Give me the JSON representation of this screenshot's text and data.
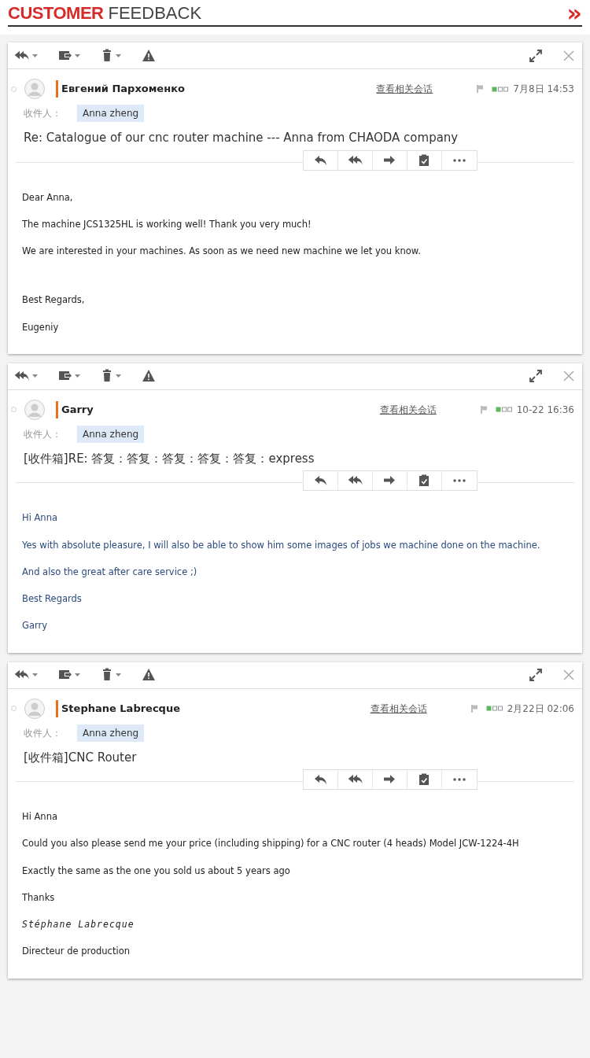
{
  "header": {
    "title_strong": "CUSTOMER",
    "title_light": "FEEDBACK",
    "arrow": "»"
  },
  "emails": [
    {
      "sender": "Евгений Пархоменко",
      "related_link": "查看相关会话",
      "date": "7月8日 14:53",
      "recipient_label": "收件人：",
      "recipient": "Anna zheng",
      "subject": "Re: Catalogue of our cnc router machine --- Anna from CHAODA company",
      "color": "#222222",
      "body": [
        {
          "kind": "text",
          "text": "Dear Anna,"
        },
        {
          "kind": "text",
          "text": "The machine JCS1325HL is working well! Thank you very much!"
        },
        {
          "kind": "text",
          "text": "We are interested in your machines. As soon as we need new machine we let you know."
        },
        {
          "kind": "gap"
        },
        {
          "kind": "text",
          "text": "Best Regards,"
        },
        {
          "kind": "text",
          "text": "Eugeniy"
        }
      ]
    },
    {
      "sender": "Garry",
      "related_link": "查看相关会话",
      "date": "10-22 16:36",
      "recipient_label": "收件人：",
      "recipient": "Anna zheng",
      "subject": "[收件箱]RE: 答复：答复：答复：答复：答复：express",
      "color": "#2b4a7e",
      "body": [
        {
          "kind": "text",
          "text": "Hi Anna"
        },
        {
          "kind": "text",
          "text": "Yes with absolute pleasure, I will also be able to show him some images of jobs we machine done on the machine."
        },
        {
          "kind": "text",
          "text": "And also the great after care service ;)"
        },
        {
          "kind": "text",
          "text": "Best Regards"
        },
        {
          "kind": "text",
          "text": "Garry"
        }
      ]
    },
    {
      "sender": "Stephane Labrecque",
      "related_link": "查看相关会话",
      "date": "2月22日 02:06",
      "recipient_label": "收件人：",
      "recipient": "Anna zheng",
      "subject": "[收件箱]CNC Router",
      "color": "#222222",
      "body": [
        {
          "kind": "text",
          "text": "Hi Anna"
        },
        {
          "kind": "text",
          "text": "Could you also please send me your price (including shipping) for a CNC router (4 heads) Model JCW-1224-4H"
        },
        {
          "kind": "text",
          "text": "Exactly the same as the one you sold us about 5 years ago"
        },
        {
          "kind": "text",
          "text": "Thanks"
        },
        {
          "kind": "signature",
          "text": "Stéphane Labrecque"
        },
        {
          "kind": "text",
          "text": "Directeur de production"
        }
      ]
    }
  ]
}
